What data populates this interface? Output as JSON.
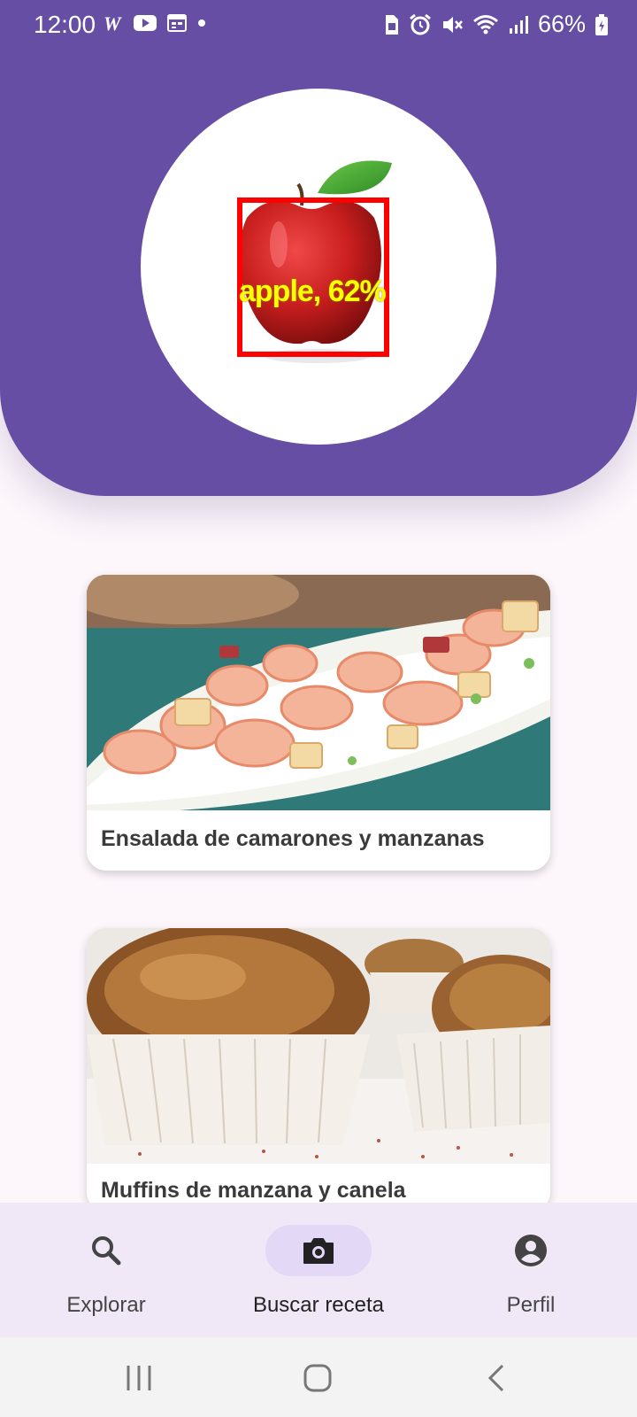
{
  "status_bar": {
    "time": "12:00",
    "battery": "66%",
    "left_icons": [
      "w-icon",
      "youtube-icon",
      "calendar-icon",
      "dot-icon"
    ],
    "right_icons": [
      "sim-icon",
      "alarm-icon",
      "mute-icon",
      "wifi-icon",
      "signal-icon",
      "battery-icon"
    ]
  },
  "detection": {
    "label": "apple, 62%",
    "box_color": "#ff0000",
    "label_color": "#ffff00"
  },
  "recipes": [
    {
      "title": "Ensalada de camarones y manzanas"
    },
    {
      "title": "Muffins de manzana y canela"
    }
  ],
  "bottom_nav": {
    "items": [
      {
        "label": "Explorar",
        "icon": "search-icon",
        "active": false
      },
      {
        "label": "Buscar receta",
        "icon": "camera-icon",
        "active": true
      },
      {
        "label": "Perfil",
        "icon": "account-circle-icon",
        "active": false
      }
    ]
  },
  "colors": {
    "primary": "#654ea3",
    "background": "#fdf7fc",
    "nav_background": "#f0e8f6",
    "active_indicator": "#e3d8f6"
  }
}
